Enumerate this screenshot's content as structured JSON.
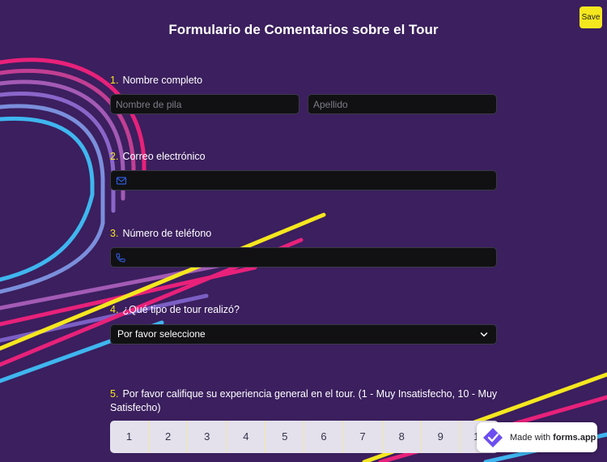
{
  "save_label": "Save",
  "title": "Formulario de Comentarios sobre el Tour",
  "questions": {
    "q1": {
      "num": "1.",
      "label": "Nombre completo",
      "first_placeholder": "Nombre de pila",
      "last_placeholder": "Apellido"
    },
    "q2": {
      "num": "2.",
      "label": "Correo electrónico",
      "icon": "envelope-icon"
    },
    "q3": {
      "num": "3.",
      "label": "Número de teléfono",
      "icon": "phone-icon"
    },
    "q4": {
      "num": "4.",
      "label": "¿Qué tipo de tour realizó?",
      "selected": "Por favor seleccione"
    },
    "q5": {
      "num": "5.",
      "label": "Por favor califique su experiencia general en el tour. (1 - Muy Insatisfecho, 10 - Muy Satisfecho)",
      "scale": [
        "1",
        "2",
        "3",
        "4",
        "5",
        "6",
        "7",
        "8",
        "9",
        "10"
      ]
    }
  },
  "badge": {
    "prefix": "Made with",
    "brand": "forms.app"
  },
  "colors": {
    "background": "#3b1f5e",
    "accent": "#f5e71e",
    "input_bg": "#111114",
    "stripe_pink": "#e8217a",
    "stripe_purple": "#a35bb5",
    "stripe_violet": "#7b5fc4",
    "stripe_blue": "#3fb6ef"
  }
}
